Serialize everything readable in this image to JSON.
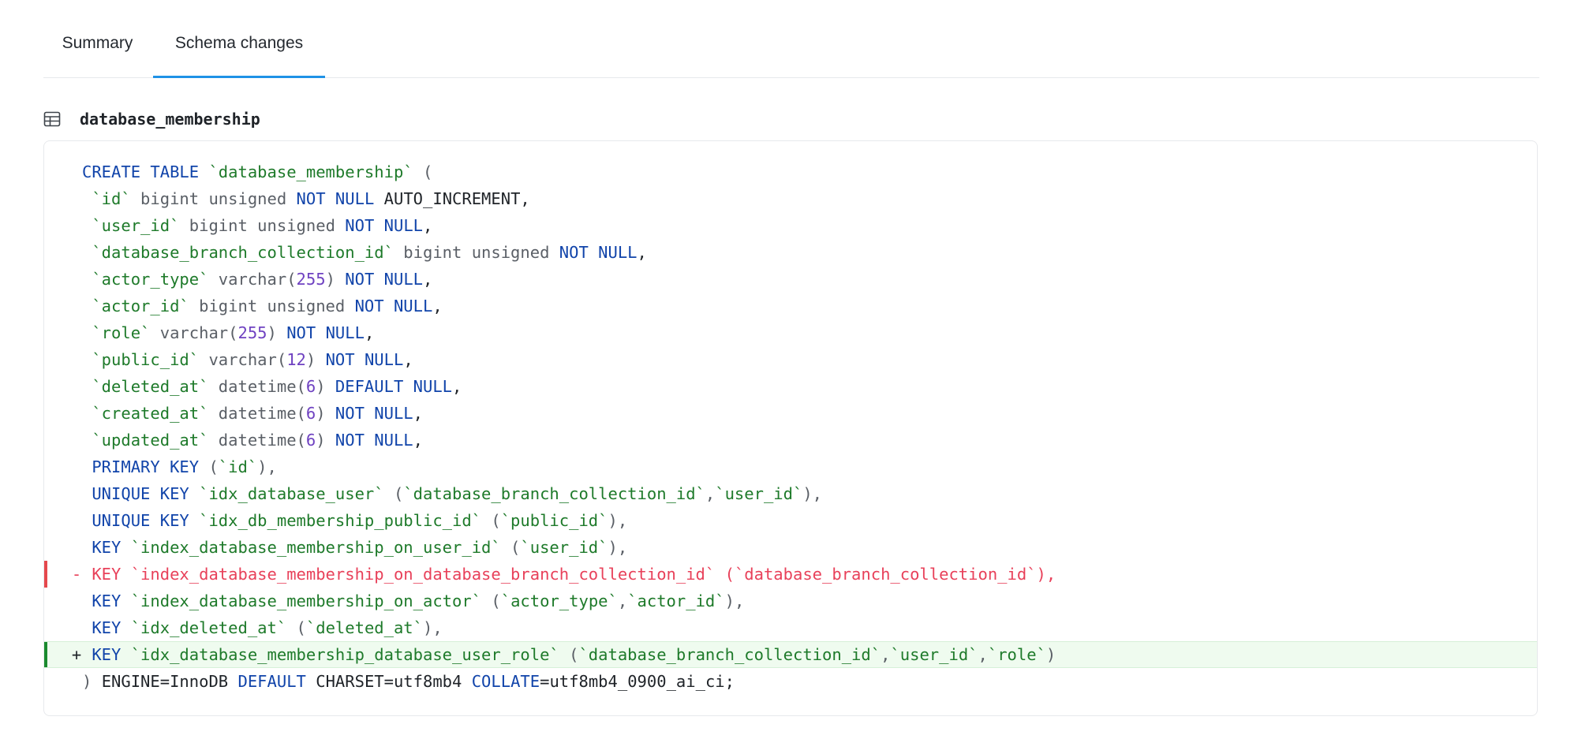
{
  "tabs": [
    {
      "label": "Summary",
      "active": false
    },
    {
      "label": "Schema changes",
      "active": true
    }
  ],
  "table": {
    "name": "database_membership",
    "icon": "table-icon"
  },
  "colors": {
    "active_tab_underline": "#1f92e6",
    "keyword": "#1144aa",
    "identifier": "#1e7a2a",
    "type": "#5a5f66",
    "number": "#6f42c1",
    "removed": "#e8415a",
    "added_bar": "#1a8a2e",
    "added_bg": "#effbef"
  },
  "diff_lines": [
    {
      "status": "ctx",
      "marker": "",
      "tokens": [
        [
          "kw",
          "CREATE TABLE "
        ],
        [
          "id",
          "`database_membership`"
        ],
        [
          "pu",
          " ("
        ]
      ]
    },
    {
      "status": "ctx",
      "marker": "",
      "tokens": [
        [
          "pl",
          " "
        ],
        [
          "id",
          "`id`"
        ],
        [
          "ty",
          " bigint unsigned "
        ],
        [
          "kw",
          "NOT NULL"
        ],
        [
          "pl",
          " AUTO_INCREMENT,"
        ]
      ]
    },
    {
      "status": "ctx",
      "marker": "",
      "tokens": [
        [
          "pl",
          " "
        ],
        [
          "id",
          "`user_id`"
        ],
        [
          "ty",
          " bigint unsigned "
        ],
        [
          "kw",
          "NOT NULL"
        ],
        [
          "pl",
          ","
        ]
      ]
    },
    {
      "status": "ctx",
      "marker": "",
      "tokens": [
        [
          "pl",
          " "
        ],
        [
          "id",
          "`database_branch_collection_id`"
        ],
        [
          "ty",
          " bigint unsigned "
        ],
        [
          "kw",
          "NOT NULL"
        ],
        [
          "pl",
          ","
        ]
      ]
    },
    {
      "status": "ctx",
      "marker": "",
      "tokens": [
        [
          "pl",
          " "
        ],
        [
          "id",
          "`actor_type`"
        ],
        [
          "ty",
          " varchar("
        ],
        [
          "num",
          "255"
        ],
        [
          "ty",
          ") "
        ],
        [
          "kw",
          "NOT NULL"
        ],
        [
          "pl",
          ","
        ]
      ]
    },
    {
      "status": "ctx",
      "marker": "",
      "tokens": [
        [
          "pl",
          " "
        ],
        [
          "id",
          "`actor_id`"
        ],
        [
          "ty",
          " bigint unsigned "
        ],
        [
          "kw",
          "NOT NULL"
        ],
        [
          "pl",
          ","
        ]
      ]
    },
    {
      "status": "ctx",
      "marker": "",
      "tokens": [
        [
          "pl",
          " "
        ],
        [
          "id",
          "`role`"
        ],
        [
          "ty",
          " varchar("
        ],
        [
          "num",
          "255"
        ],
        [
          "ty",
          ") "
        ],
        [
          "kw",
          "NOT NULL"
        ],
        [
          "pl",
          ","
        ]
      ]
    },
    {
      "status": "ctx",
      "marker": "",
      "tokens": [
        [
          "pl",
          " "
        ],
        [
          "id",
          "`public_id`"
        ],
        [
          "ty",
          " varchar("
        ],
        [
          "num",
          "12"
        ],
        [
          "ty",
          ") "
        ],
        [
          "kw",
          "NOT NULL"
        ],
        [
          "pl",
          ","
        ]
      ]
    },
    {
      "status": "ctx",
      "marker": "",
      "tokens": [
        [
          "pl",
          " "
        ],
        [
          "id",
          "`deleted_at`"
        ],
        [
          "ty",
          " datetime("
        ],
        [
          "num",
          "6"
        ],
        [
          "ty",
          ") "
        ],
        [
          "kw",
          "DEFAULT NULL"
        ],
        [
          "pl",
          ","
        ]
      ]
    },
    {
      "status": "ctx",
      "marker": "",
      "tokens": [
        [
          "pl",
          " "
        ],
        [
          "id",
          "`created_at`"
        ],
        [
          "ty",
          " datetime("
        ],
        [
          "num",
          "6"
        ],
        [
          "ty",
          ") "
        ],
        [
          "kw",
          "NOT NULL"
        ],
        [
          "pl",
          ","
        ]
      ]
    },
    {
      "status": "ctx",
      "marker": "",
      "tokens": [
        [
          "pl",
          " "
        ],
        [
          "id",
          "`updated_at`"
        ],
        [
          "ty",
          " datetime("
        ],
        [
          "num",
          "6"
        ],
        [
          "ty",
          ") "
        ],
        [
          "kw",
          "NOT NULL"
        ],
        [
          "pl",
          ","
        ]
      ]
    },
    {
      "status": "ctx",
      "marker": "",
      "tokens": [
        [
          "pl",
          " "
        ],
        [
          "kw",
          "PRIMARY KEY"
        ],
        [
          "pu",
          " ("
        ],
        [
          "id",
          "`id`"
        ],
        [
          "pu",
          "),"
        ]
      ]
    },
    {
      "status": "ctx",
      "marker": "",
      "tokens": [
        [
          "pl",
          " "
        ],
        [
          "kw",
          "UNIQUE KEY"
        ],
        [
          "pl",
          " "
        ],
        [
          "id",
          "`idx_database_user`"
        ],
        [
          "pu",
          " ("
        ],
        [
          "id",
          "`database_branch_collection_id`"
        ],
        [
          "pu",
          ","
        ],
        [
          "id",
          "`user_id`"
        ],
        [
          "pu",
          "),"
        ]
      ]
    },
    {
      "status": "ctx",
      "marker": "",
      "tokens": [
        [
          "pl",
          " "
        ],
        [
          "kw",
          "UNIQUE KEY"
        ],
        [
          "pl",
          " "
        ],
        [
          "id",
          "`idx_db_membership_public_id`"
        ],
        [
          "pu",
          " ("
        ],
        [
          "id",
          "`public_id`"
        ],
        [
          "pu",
          "),"
        ]
      ]
    },
    {
      "status": "ctx",
      "marker": "",
      "tokens": [
        [
          "pl",
          " "
        ],
        [
          "kw",
          "KEY"
        ],
        [
          "pl",
          " "
        ],
        [
          "id",
          "`index_database_membership_on_user_id`"
        ],
        [
          "pu",
          " ("
        ],
        [
          "id",
          "`user_id`"
        ],
        [
          "pu",
          "),"
        ]
      ]
    },
    {
      "status": "removed",
      "marker": "-",
      "tokens": [
        [
          "pl",
          " "
        ],
        [
          "kw",
          "KEY"
        ],
        [
          "pl",
          " "
        ],
        [
          "id",
          "`index_database_membership_on_database_branch_collection_id`"
        ],
        [
          "pu",
          " ("
        ],
        [
          "id",
          "`database_branch_collection_id`"
        ],
        [
          "pu",
          "),"
        ]
      ]
    },
    {
      "status": "ctx",
      "marker": "",
      "tokens": [
        [
          "pl",
          " "
        ],
        [
          "kw",
          "KEY"
        ],
        [
          "pl",
          " "
        ],
        [
          "id",
          "`index_database_membership_on_actor`"
        ],
        [
          "pu",
          " ("
        ],
        [
          "id",
          "`actor_type`"
        ],
        [
          "pu",
          ","
        ],
        [
          "id",
          "`actor_id`"
        ],
        [
          "pu",
          "),"
        ]
      ]
    },
    {
      "status": "ctx",
      "marker": "",
      "tokens": [
        [
          "pl",
          " "
        ],
        [
          "kw",
          "KEY"
        ],
        [
          "pl",
          " "
        ],
        [
          "id",
          "`idx_deleted_at`"
        ],
        [
          "pu",
          " ("
        ],
        [
          "id",
          "`deleted_at`"
        ],
        [
          "pu",
          "),"
        ]
      ]
    },
    {
      "status": "added",
      "marker": "+",
      "tokens": [
        [
          "pl",
          " "
        ],
        [
          "kw",
          "KEY"
        ],
        [
          "pl",
          " "
        ],
        [
          "id",
          "`idx_database_membership_database_user_role`"
        ],
        [
          "pu",
          " ("
        ],
        [
          "id",
          "`database_branch_collection_id`"
        ],
        [
          "pu",
          ","
        ],
        [
          "id",
          "`user_id`"
        ],
        [
          "pu",
          ","
        ],
        [
          "id",
          "`role`"
        ],
        [
          "pu",
          ")"
        ]
      ]
    },
    {
      "status": "ctx",
      "marker": "",
      "tokens": [
        [
          "pu",
          ") "
        ],
        [
          "pl",
          "ENGINE=InnoDB "
        ],
        [
          "kw",
          "DEFAULT"
        ],
        [
          "pl",
          " CHARSET=utf8mb4 "
        ],
        [
          "kw",
          "COLLATE"
        ],
        [
          "pl",
          "=utf8mb4_0900_ai_ci;"
        ]
      ]
    }
  ]
}
